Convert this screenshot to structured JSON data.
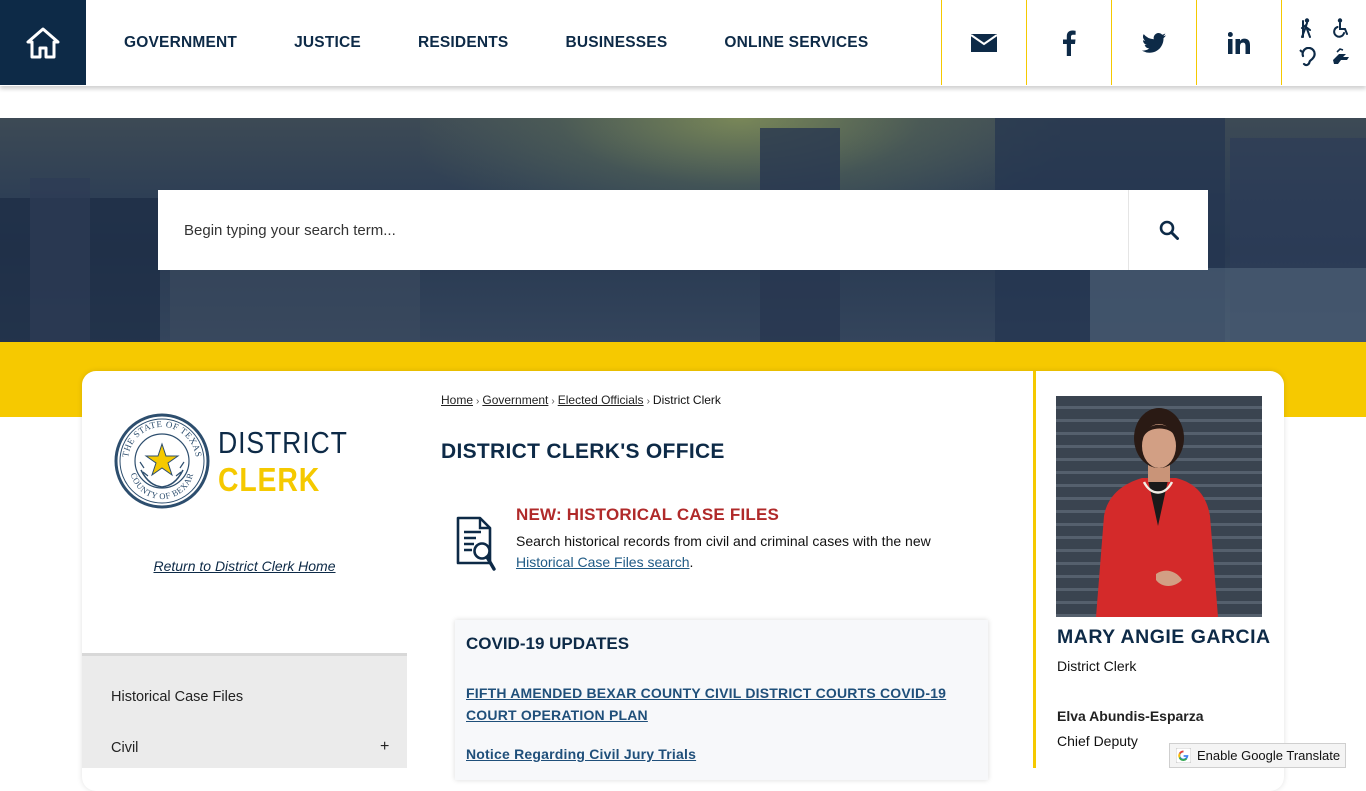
{
  "nav": {
    "items": [
      "GOVERNMENT",
      "JUSTICE",
      "RESIDENTS",
      "BUSINESSES",
      "ONLINE SERVICES"
    ]
  },
  "social": {
    "icons": [
      "envelope-icon",
      "facebook-icon",
      "twitter-icon",
      "linkedin-icon"
    ]
  },
  "accessibility": {
    "icons": [
      "walking-person-icon",
      "wheelchair-icon",
      "hearing-icon",
      "sign-language-icon"
    ]
  },
  "search": {
    "placeholder": "Begin typing your search term..."
  },
  "sidebar": {
    "logo_line1": "DISTRICT",
    "logo_line2": "CLERK",
    "seal_text_top": "THE STATE OF TEXAS",
    "seal_text_bottom": "COUNTY OF BEXAR",
    "return_link": "Return to District Clerk Home",
    "items": [
      {
        "label": "Historical Case Files",
        "expandable": false
      },
      {
        "label": "Civil",
        "expandable": true,
        "toggle": "+"
      }
    ]
  },
  "breadcrumb": {
    "items": [
      "Home",
      "Government",
      "Elected Officials"
    ],
    "current": "District Clerk",
    "separator": "›"
  },
  "main": {
    "title": "DISTRICT CLERK'S OFFICE",
    "callout": {
      "title": "NEW: HISTORICAL CASE FILES",
      "text": "Search historical records from civil and criminal cases with the new",
      "link": "Historical Case Files search",
      "after_link": "."
    },
    "covid": {
      "title": "COVID-19 UPDATES",
      "links": [
        "FIFTH AMENDED BEXAR COUNTY CIVIL DISTRICT COURTS COVID-19 COURT OPERATION PLAN",
        "Notice Regarding Civil Jury Trials"
      ]
    }
  },
  "official": {
    "name": "MARY ANGIE GARCIA",
    "title": "District Clerk",
    "deputy_name": "Elva Abundis-Esparza",
    "deputy_title": "Chief Deputy"
  },
  "translate": {
    "label": "Enable Google Translate"
  },
  "colors": {
    "navy": "#0d2a47",
    "yellow": "#f6c900",
    "callout_red": "#b02a2a",
    "link_blue": "#1f4f7a"
  }
}
